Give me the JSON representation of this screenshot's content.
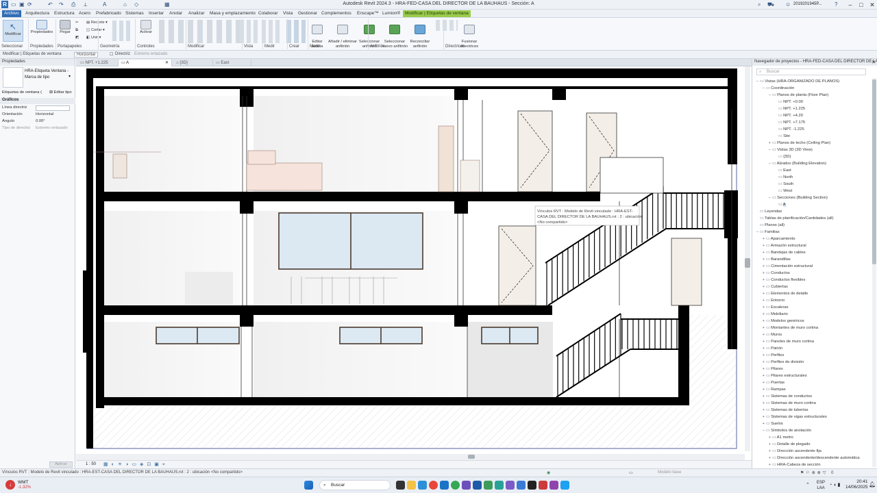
{
  "window": {
    "title": "Autodesk Revit 2024.3 - HRA-FED-CASA DEL DIRECTOR DE LA BAUHAUS - Sección: A",
    "user": "2019201945P...",
    "app_icon_letter": "R"
  },
  "ribbon_tabs": [
    "Archivo",
    "Arquitectura",
    "Estructura",
    "Acero",
    "Prefabricado",
    "Sistemas",
    "Insertar",
    "Anotar",
    "Analizar",
    "Masa y emplazamiento",
    "Colaborar",
    "Vista",
    "Gestionar",
    "Complementos",
    "Enscape™",
    "Lumion®",
    "Modificar | Etiquetas de ventana"
  ],
  "ribbon": {
    "buttons": {
      "modify": "Modificar",
      "properties": "Propiedades",
      "paste": "Pegar",
      "activate": "Activar",
      "edit_family": "Editar\nfamilia",
      "add_remove_host": "Añadir / eliminar\nanfitrión",
      "select_host": "Seleccionar\nanfitrión",
      "select_new_host": "Seleccionar\nnuevo anfitrión",
      "reconcile_host": "Reconciliar\nanfitrión",
      "merge_leaders": "Fusionar\ndirectrices"
    },
    "small": {
      "cut": "Recorte",
      "cut2": "Cortar",
      "join": "Unir"
    },
    "groups": [
      "Seleccionar",
      "Propiedades",
      "Portapapeles",
      "Geometría",
      "Controles",
      "Modificar",
      "Vista",
      "Medir",
      "Crear",
      "Modo",
      "Anfitrión",
      "Directrices"
    ]
  },
  "options_bar": {
    "context": "Modificar | Etiquetas de ventana",
    "orientation": "Horizontal",
    "leader_label": "Directriz",
    "leader_value": "Extremo enlazado"
  },
  "properties": {
    "title": "Propiedades",
    "type_name": "HRA-Etiqueta Ventana - Marca de tipo",
    "selector": "Etiquetas de ventana (",
    "edit_type": "Editar tipo",
    "section": "Gráficos",
    "rows": [
      {
        "label": "Línea directriz",
        "value": ""
      },
      {
        "label": "Orientación",
        "value": "Horizontal"
      },
      {
        "label": "Ángulo",
        "value": "0.00°"
      },
      {
        "label": "Tipo de directriz",
        "value": "Extremo enlazado"
      }
    ],
    "apply": "Aplicar"
  },
  "view_tabs": [
    {
      "label": "NPT. +1.225",
      "active": false
    },
    {
      "label": "A",
      "active": true
    },
    {
      "label": "{3D}",
      "active": false
    },
    {
      "label": "East",
      "active": false
    }
  ],
  "canvas": {
    "tooltip_lines": [
      "Vínculos RVT : Modelo de Revit vinculado : HRA-EST-",
      "CASA DEL DIRECTOR DE LA BAUHAUS.rvt : 2 : ubicación",
      "<No compartido>"
    ],
    "scale": "1 : 50"
  },
  "browser": {
    "title": "Navegador de proyectos - HRA-FED-CASA DEL DIRECTOR DE LA BAUHAUS",
    "search_placeholder": "Buscar",
    "tree": [
      {
        "l": 0,
        "t": "−",
        "label": "Vistas (HRA-ORGANIZADO DE PLANOS)"
      },
      {
        "l": 1,
        "t": "−",
        "label": "Coordinación"
      },
      {
        "l": 2,
        "t": "−",
        "label": "Planos de planta (Floor Plan)"
      },
      {
        "l": 3,
        "t": "",
        "label": "NPT. +0.00"
      },
      {
        "l": 3,
        "t": "",
        "label": "NPT. +1.225"
      },
      {
        "l": 3,
        "t": "",
        "label": "NPT. +4.20"
      },
      {
        "l": 3,
        "t": "",
        "label": "NPT. +7.175"
      },
      {
        "l": 3,
        "t": "",
        "label": "NPT. -1.225"
      },
      {
        "l": 3,
        "t": "",
        "label": "Site"
      },
      {
        "l": 2,
        "t": "+",
        "label": "Planos de techo (Ceiling Plan)"
      },
      {
        "l": 2,
        "t": "−",
        "label": "Vistas 3D (3D View)"
      },
      {
        "l": 3,
        "t": "",
        "label": "{3D}"
      },
      {
        "l": 2,
        "t": "−",
        "label": "Alzados (Building Elevation)"
      },
      {
        "l": 3,
        "t": "",
        "label": "East"
      },
      {
        "l": 3,
        "t": "",
        "label": "North"
      },
      {
        "l": 3,
        "t": "",
        "label": "South"
      },
      {
        "l": 3,
        "t": "",
        "label": "West"
      },
      {
        "l": 2,
        "t": "−",
        "label": "Secciones (Building Section)"
      },
      {
        "l": 3,
        "t": "",
        "label": "A"
      },
      {
        "l": 0,
        "t": "",
        "label": "Leyendas"
      },
      {
        "l": 0,
        "t": "",
        "label": "Tablas de planificación/Cantidades (all)"
      },
      {
        "l": 0,
        "t": "",
        "label": "Planos (all)"
      },
      {
        "l": 0,
        "t": "−",
        "label": "Familias"
      },
      {
        "l": 1,
        "t": "+",
        "label": "Aparcamiento"
      },
      {
        "l": 1,
        "t": "+",
        "label": "Armazón estructural"
      },
      {
        "l": 1,
        "t": "+",
        "label": "Bandejas de cables"
      },
      {
        "l": 1,
        "t": "+",
        "label": "Barandillas"
      },
      {
        "l": 1,
        "t": "+",
        "label": "Cimentación estructural"
      },
      {
        "l": 1,
        "t": "+",
        "label": "Conductos"
      },
      {
        "l": 1,
        "t": "+",
        "label": "Conductos flexibles"
      },
      {
        "l": 1,
        "t": "+",
        "label": "Cubiertas"
      },
      {
        "l": 1,
        "t": "+",
        "label": "Elementos de detalle"
      },
      {
        "l": 1,
        "t": "+",
        "label": "Entorno"
      },
      {
        "l": 1,
        "t": "+",
        "label": "Escaleras"
      },
      {
        "l": 1,
        "t": "+",
        "label": "Mobiliario"
      },
      {
        "l": 1,
        "t": "+",
        "label": "Modelos genéricos"
      },
      {
        "l": 1,
        "t": "+",
        "label": "Montantes de muro cortina"
      },
      {
        "l": 1,
        "t": "+",
        "label": "Muros"
      },
      {
        "l": 1,
        "t": "+",
        "label": "Paneles de muro cortina"
      },
      {
        "l": 1,
        "t": "+",
        "label": "Patrón"
      },
      {
        "l": 1,
        "t": "+",
        "label": "Perfiles"
      },
      {
        "l": 1,
        "t": "+",
        "label": "Perfiles de división"
      },
      {
        "l": 1,
        "t": "+",
        "label": "Pilares"
      },
      {
        "l": 1,
        "t": "+",
        "label": "Pilares estructurales"
      },
      {
        "l": 1,
        "t": "+",
        "label": "Puertas"
      },
      {
        "l": 1,
        "t": "+",
        "label": "Rampas"
      },
      {
        "l": 1,
        "t": "+",
        "label": "Sistemas de conductos"
      },
      {
        "l": 1,
        "t": "+",
        "label": "Sistemas de muro cortina"
      },
      {
        "l": 1,
        "t": "+",
        "label": "Sistemas de tuberías"
      },
      {
        "l": 1,
        "t": "+",
        "label": "Sistemas de vigas estructurales"
      },
      {
        "l": 1,
        "t": "+",
        "label": "Suelos"
      },
      {
        "l": 1,
        "t": "−",
        "label": "Símbolos de anotación"
      },
      {
        "l": 2,
        "t": "+",
        "label": "A1 metric"
      },
      {
        "l": 2,
        "t": "+",
        "label": "Detalle de plegado"
      },
      {
        "l": 2,
        "t": "+",
        "label": "Dirección ascendente fija"
      },
      {
        "l": 2,
        "t": "+",
        "label": "Dirección ascendente/descendente automática"
      },
      {
        "l": 2,
        "t": "+",
        "label": "HRA-Cabeza de sección"
      }
    ]
  },
  "status_bar": {
    "message": "Vínculos RVT : Modelo de Revit vinculado : HRA-EST-CASA DEL DIRECTOR DE LA BAUHAUS.rvt : 2 : ubicación <No compartido>",
    "model": "Modelo base"
  },
  "taskbar": {
    "stock_name": "WMT",
    "stock_change": "-1.32%",
    "search": "Buscar",
    "lang1": "ESP",
    "lang2": "LAA",
    "time": "20:41",
    "date": "14/06/2025"
  },
  "colors": {
    "accent": "#2f6cb5",
    "context_tab": "#9acb4c",
    "wall": "#000000",
    "glass": "#dce9f3",
    "frame": "#4a3a2e"
  }
}
